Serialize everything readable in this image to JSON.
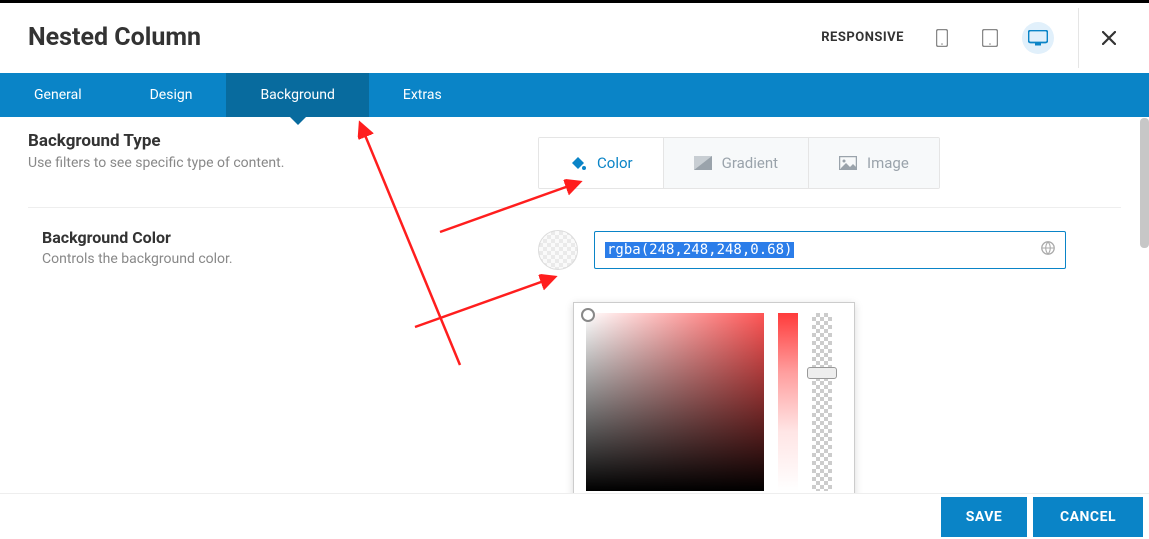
{
  "header": {
    "title": "Nested Column",
    "responsive_label": "RESPONSIVE"
  },
  "tabs": {
    "general": "General",
    "design": "Design",
    "background": "Background",
    "extras": "Extras"
  },
  "section_bgtype": {
    "title": "Background Type",
    "desc": "Use filters to see specific type of content.",
    "options": {
      "color": "Color",
      "gradient": "Gradient",
      "image": "Image"
    }
  },
  "section_bgcolor": {
    "title": "Background Color",
    "desc": "Controls the background color.",
    "value": "rgba(248,248,248,0.68)"
  },
  "footer": {
    "save": "SAVE",
    "cancel": "CANCEL"
  }
}
